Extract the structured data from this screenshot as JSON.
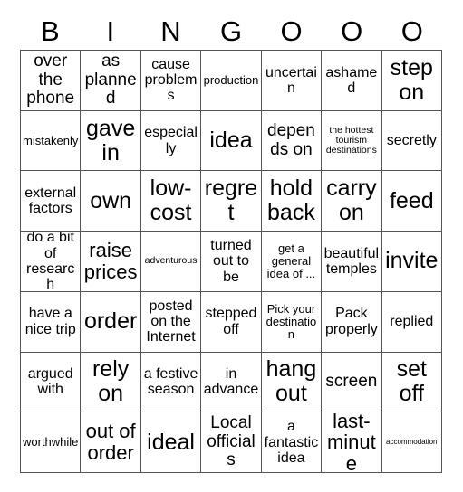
{
  "card": {
    "title": "BINGOOO",
    "header_letters": [
      "B",
      "I",
      "N",
      "G",
      "O",
      "O",
      "O"
    ],
    "columns": 7,
    "rows": 7,
    "colors": {
      "background": "#ffffff",
      "grid_line": "#555555",
      "text": "#000000"
    },
    "cells": [
      [
        {
          "text": "over the phone",
          "size": "lg"
        },
        {
          "text": "as planned",
          "size": "lg"
        },
        {
          "text": "cause problems",
          "size": "md"
        },
        {
          "text": "production",
          "size": "sm"
        },
        {
          "text": "uncertain",
          "size": "md"
        },
        {
          "text": "ashamed",
          "size": "md"
        },
        {
          "text": "step on",
          "size": "xxl"
        }
      ],
      [
        {
          "text": "mistakenly",
          "size": "sm"
        },
        {
          "text": "gave in",
          "size": "xxl"
        },
        {
          "text": "especially",
          "size": "md"
        },
        {
          "text": "idea",
          "size": "xxl"
        },
        {
          "text": "depends on",
          "size": "lg"
        },
        {
          "text": "the hottest tourism destinations",
          "size": "xs"
        },
        {
          "text": "secretly",
          "size": "md"
        }
      ],
      [
        {
          "text": "external factors",
          "size": "md"
        },
        {
          "text": "own",
          "size": "xxl"
        },
        {
          "text": "low-cost",
          "size": "xxl"
        },
        {
          "text": "regret",
          "size": "xxl"
        },
        {
          "text": "hold back",
          "size": "xxl"
        },
        {
          "text": "carry on",
          "size": "xxl"
        },
        {
          "text": "feed",
          "size": "xxl"
        }
      ],
      [
        {
          "text": "do a bit of research",
          "size": "md"
        },
        {
          "text": "raise prices",
          "size": "xl"
        },
        {
          "text": "adventurous",
          "size": "xs"
        },
        {
          "text": "turned out to be",
          "size": "md"
        },
        {
          "text": "get a general idea of ...",
          "size": "sm"
        },
        {
          "text": "beautiful temples",
          "size": "md"
        },
        {
          "text": "invite",
          "size": "xxl"
        }
      ],
      [
        {
          "text": "have a nice trip",
          "size": "md"
        },
        {
          "text": "order",
          "size": "xxl"
        },
        {
          "text": "posted on the Internet",
          "size": "md"
        },
        {
          "text": "stepped off",
          "size": "md"
        },
        {
          "text": "Pick your destination",
          "size": "sm"
        },
        {
          "text": "Pack properly",
          "size": "md"
        },
        {
          "text": "replied",
          "size": "md"
        }
      ],
      [
        {
          "text": "argued with",
          "size": "md"
        },
        {
          "text": "rely on",
          "size": "xxl"
        },
        {
          "text": "a festive season",
          "size": "md"
        },
        {
          "text": "in advance",
          "size": "md"
        },
        {
          "text": "hang out",
          "size": "xxl"
        },
        {
          "text": "screen",
          "size": "lg"
        },
        {
          "text": "set off",
          "size": "xxl"
        }
      ],
      [
        {
          "text": "worthwhile",
          "size": "sm"
        },
        {
          "text": "out of order",
          "size": "xl"
        },
        {
          "text": "ideal",
          "size": "xxl"
        },
        {
          "text": "Local officials",
          "size": "lg"
        },
        {
          "text": "a fantastic idea",
          "size": "md"
        },
        {
          "text": "last-minute",
          "size": "xl"
        },
        {
          "text": "accommodation",
          "size": "xxs"
        }
      ]
    ]
  }
}
